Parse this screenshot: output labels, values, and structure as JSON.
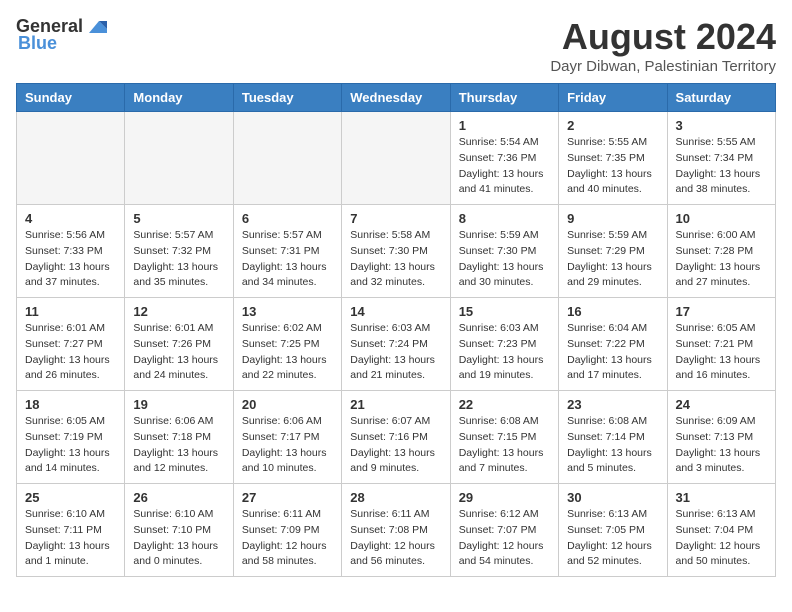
{
  "header": {
    "logo_general": "General",
    "logo_blue": "Blue",
    "month_year": "August 2024",
    "location": "Dayr Dibwan, Palestinian Territory"
  },
  "days_of_week": [
    "Sunday",
    "Monday",
    "Tuesday",
    "Wednesday",
    "Thursday",
    "Friday",
    "Saturday"
  ],
  "weeks": [
    [
      {
        "day": "",
        "info": ""
      },
      {
        "day": "",
        "info": ""
      },
      {
        "day": "",
        "info": ""
      },
      {
        "day": "",
        "info": ""
      },
      {
        "day": "1",
        "info": "Sunrise: 5:54 AM\nSunset: 7:36 PM\nDaylight: 13 hours\nand 41 minutes."
      },
      {
        "day": "2",
        "info": "Sunrise: 5:55 AM\nSunset: 7:35 PM\nDaylight: 13 hours\nand 40 minutes."
      },
      {
        "day": "3",
        "info": "Sunrise: 5:55 AM\nSunset: 7:34 PM\nDaylight: 13 hours\nand 38 minutes."
      }
    ],
    [
      {
        "day": "4",
        "info": "Sunrise: 5:56 AM\nSunset: 7:33 PM\nDaylight: 13 hours\nand 37 minutes."
      },
      {
        "day": "5",
        "info": "Sunrise: 5:57 AM\nSunset: 7:32 PM\nDaylight: 13 hours\nand 35 minutes."
      },
      {
        "day": "6",
        "info": "Sunrise: 5:57 AM\nSunset: 7:31 PM\nDaylight: 13 hours\nand 34 minutes."
      },
      {
        "day": "7",
        "info": "Sunrise: 5:58 AM\nSunset: 7:30 PM\nDaylight: 13 hours\nand 32 minutes."
      },
      {
        "day": "8",
        "info": "Sunrise: 5:59 AM\nSunset: 7:30 PM\nDaylight: 13 hours\nand 30 minutes."
      },
      {
        "day": "9",
        "info": "Sunrise: 5:59 AM\nSunset: 7:29 PM\nDaylight: 13 hours\nand 29 minutes."
      },
      {
        "day": "10",
        "info": "Sunrise: 6:00 AM\nSunset: 7:28 PM\nDaylight: 13 hours\nand 27 minutes."
      }
    ],
    [
      {
        "day": "11",
        "info": "Sunrise: 6:01 AM\nSunset: 7:27 PM\nDaylight: 13 hours\nand 26 minutes."
      },
      {
        "day": "12",
        "info": "Sunrise: 6:01 AM\nSunset: 7:26 PM\nDaylight: 13 hours\nand 24 minutes."
      },
      {
        "day": "13",
        "info": "Sunrise: 6:02 AM\nSunset: 7:25 PM\nDaylight: 13 hours\nand 22 minutes."
      },
      {
        "day": "14",
        "info": "Sunrise: 6:03 AM\nSunset: 7:24 PM\nDaylight: 13 hours\nand 21 minutes."
      },
      {
        "day": "15",
        "info": "Sunrise: 6:03 AM\nSunset: 7:23 PM\nDaylight: 13 hours\nand 19 minutes."
      },
      {
        "day": "16",
        "info": "Sunrise: 6:04 AM\nSunset: 7:22 PM\nDaylight: 13 hours\nand 17 minutes."
      },
      {
        "day": "17",
        "info": "Sunrise: 6:05 AM\nSunset: 7:21 PM\nDaylight: 13 hours\nand 16 minutes."
      }
    ],
    [
      {
        "day": "18",
        "info": "Sunrise: 6:05 AM\nSunset: 7:19 PM\nDaylight: 13 hours\nand 14 minutes."
      },
      {
        "day": "19",
        "info": "Sunrise: 6:06 AM\nSunset: 7:18 PM\nDaylight: 13 hours\nand 12 minutes."
      },
      {
        "day": "20",
        "info": "Sunrise: 6:06 AM\nSunset: 7:17 PM\nDaylight: 13 hours\nand 10 minutes."
      },
      {
        "day": "21",
        "info": "Sunrise: 6:07 AM\nSunset: 7:16 PM\nDaylight: 13 hours\nand 9 minutes."
      },
      {
        "day": "22",
        "info": "Sunrise: 6:08 AM\nSunset: 7:15 PM\nDaylight: 13 hours\nand 7 minutes."
      },
      {
        "day": "23",
        "info": "Sunrise: 6:08 AM\nSunset: 7:14 PM\nDaylight: 13 hours\nand 5 minutes."
      },
      {
        "day": "24",
        "info": "Sunrise: 6:09 AM\nSunset: 7:13 PM\nDaylight: 13 hours\nand 3 minutes."
      }
    ],
    [
      {
        "day": "25",
        "info": "Sunrise: 6:10 AM\nSunset: 7:11 PM\nDaylight: 13 hours\nand 1 minute."
      },
      {
        "day": "26",
        "info": "Sunrise: 6:10 AM\nSunset: 7:10 PM\nDaylight: 13 hours\nand 0 minutes."
      },
      {
        "day": "27",
        "info": "Sunrise: 6:11 AM\nSunset: 7:09 PM\nDaylight: 12 hours\nand 58 minutes."
      },
      {
        "day": "28",
        "info": "Sunrise: 6:11 AM\nSunset: 7:08 PM\nDaylight: 12 hours\nand 56 minutes."
      },
      {
        "day": "29",
        "info": "Sunrise: 6:12 AM\nSunset: 7:07 PM\nDaylight: 12 hours\nand 54 minutes."
      },
      {
        "day": "30",
        "info": "Sunrise: 6:13 AM\nSunset: 7:05 PM\nDaylight: 12 hours\nand 52 minutes."
      },
      {
        "day": "31",
        "info": "Sunrise: 6:13 AM\nSunset: 7:04 PM\nDaylight: 12 hours\nand 50 minutes."
      }
    ]
  ]
}
